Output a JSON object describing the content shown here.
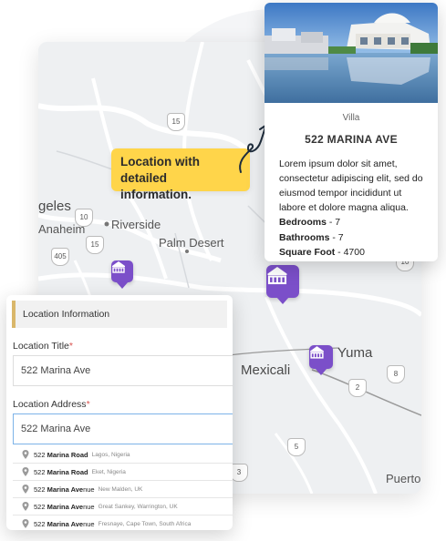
{
  "callout": {
    "line1": "Location with",
    "line2": "detailed information."
  },
  "map": {
    "labels": {
      "riverside": "Riverside",
      "anaheim": "Anaheim",
      "angeles": "geles",
      "palm_desert": "Palm Desert",
      "mexicali": "Mexicali",
      "yuma": "Yuma",
      "puerto": "Puerto"
    },
    "shields": [
      "15",
      "10",
      "15",
      "405",
      "10",
      "8",
      "2",
      "5",
      "3"
    ]
  },
  "property": {
    "type": "Villa",
    "title": "522 MARINA AVE",
    "description": "Lorem ipsum dolor sit amet, consectetur adipiscing elit, sed do eiusmod tempor incididunt ut labore et dolore magna aliqua.",
    "features": [
      {
        "label": "Bedrooms",
        "value": " - 7"
      },
      {
        "label": "Bathrooms",
        "value": " - 7"
      },
      {
        "label": "Square Foot",
        "value": " - 4700"
      }
    ]
  },
  "form": {
    "header": "Location Information",
    "title_label": "Location Title",
    "title_value": "522 Marina Ave",
    "address_label": "Location Address",
    "address_value": "522 Marina Ave",
    "required_mark": "*",
    "suggestions": [
      {
        "prefix": "522 ",
        "bold": "Marina Road",
        "rest": "",
        "location": "Lagos, Nigeria"
      },
      {
        "prefix": "522 ",
        "bold": "Marina Road",
        "rest": "",
        "location": "Eket, Nigeria"
      },
      {
        "prefix": "522 ",
        "bold": "Marina Ave",
        "rest": "nue",
        "location": "New Malden, UK"
      },
      {
        "prefix": "522 ",
        "bold": "Marina Ave",
        "rest": "nue",
        "location": "Great Sankey, Warrington, UK"
      },
      {
        "prefix": "522 ",
        "bold": "Marina Ave",
        "rest": "nue",
        "location": "Fresnaye, Cape Town, South Africa"
      }
    ]
  },
  "colors": {
    "pin": "#7b4fc9",
    "callout": "#ffd54a",
    "required": "#d9534f",
    "active_border": "#7db3e8"
  },
  "icons": [
    "house-pin-icon",
    "map-pin-icon",
    "curved-arrow-icon"
  ]
}
